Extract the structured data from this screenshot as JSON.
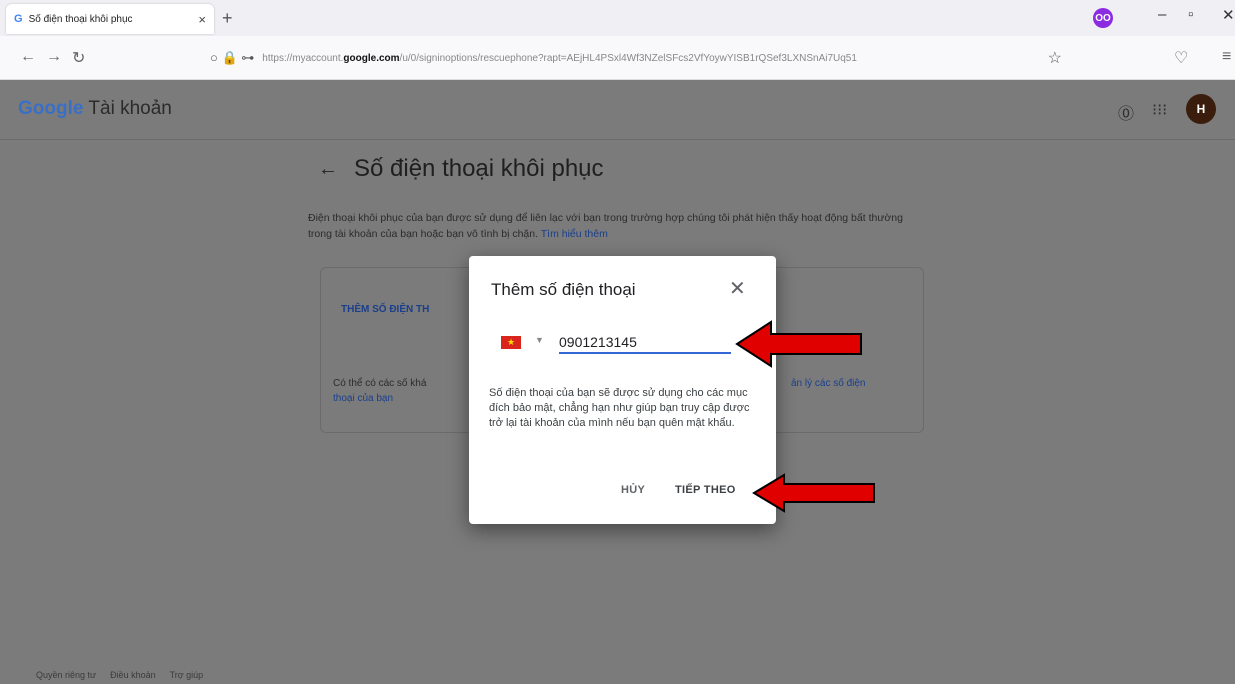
{
  "browser": {
    "tab_title": "Số điện thoại khôi phục",
    "tab_close": "×",
    "new_tab": "+",
    "url_prefix": "https://myaccount.",
    "url_domain": "google.com",
    "url_rest": "/u/0/signinoptions/rescuephone?rapt=AEjHL4PSxl4Wf3NZelSFcs2VfYoywYISB1rQSef3LXNSnAi7Uq51",
    "extension_label": "OO"
  },
  "header": {
    "logo_google": "Google",
    "logo_product": "Tài khoản",
    "avatar_letter": "H"
  },
  "main": {
    "title": "Số điện thoại khôi phục",
    "description": "Điện thoại khôi phục của bạn được sử dụng để liên lạc với bạn trong trường hợp chúng tôi phát hiện thấy hoạt động bất thường trong tài khoản của bạn hoặc bạn vô tình bị chặn.",
    "learn_more": "Tìm hiểu thêm",
    "card_add": "THÊM SỐ ĐIỆN TH",
    "card_note_prefix": "Có thể có các số khá",
    "card_note_link": "thoại của bạn",
    "card_note_right": "ản lý các số điện"
  },
  "footer": {
    "links": [
      "Quyền riêng tư",
      "Điều khoản",
      "Trợ giúp"
    ]
  },
  "dialog": {
    "title": "Thêm số điện thoại",
    "phone_value": "0901213145",
    "help_text": "Số điện thoại của bạn sẽ được sử dụng cho các mục đích bảo mật, chẳng hạn như giúp bạn truy cập được trở lại tài khoản của mình nếu bạn quên mật khẩu.",
    "cancel_label": "HỦY",
    "next_label": "TIẾP THEO"
  },
  "colors": {
    "accent": "#3367d6",
    "annotation_arrow": "#e00000"
  }
}
